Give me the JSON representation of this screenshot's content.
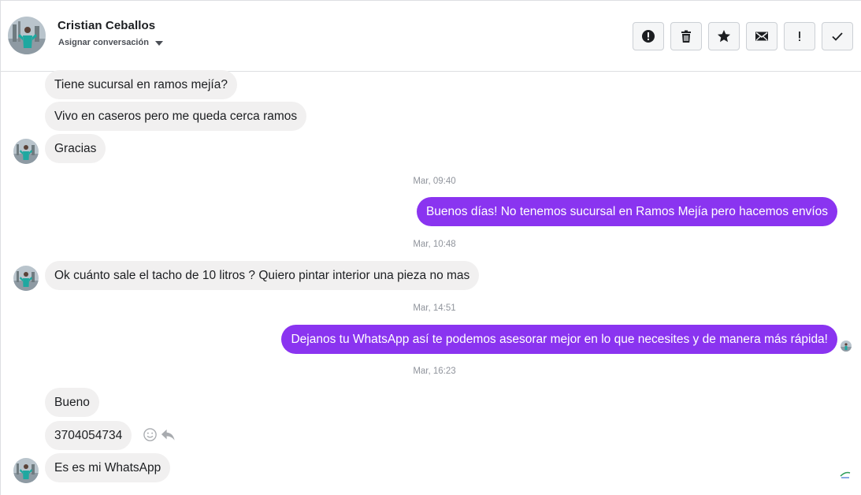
{
  "header": {
    "contact_name": "Cristian Ceballos",
    "assign_label": "Asignar conversación",
    "actions": [
      {
        "name": "alert-circle-icon"
      },
      {
        "name": "trash-icon"
      },
      {
        "name": "star-icon"
      },
      {
        "name": "envelope-icon"
      },
      {
        "name": "exclamation-icon"
      },
      {
        "name": "checkmark-icon"
      }
    ]
  },
  "messages": {
    "m1": "Tiene sucursal en ramos mejía?",
    "m2": "Vivo en caseros pero me queda cerca ramos",
    "m3": "Gracias",
    "t1": "Mar, 09:40",
    "m4": "Buenos días! No tenemos sucursal en Ramos Mejía pero hacemos envíos",
    "t2": "Mar, 10:48",
    "m5": "Ok cuánto sale el tacho de 10 litros ? Quiero pintar interior una pieza no mas",
    "t3": "Mar, 14:51",
    "m6": "Dejanos tu WhatsApp así te podemos asesorar mejor en lo que necesites y de manera más rápida!",
    "t4": "Mar, 16:23",
    "m7": "Bueno",
    "m8": "3704054734",
    "m9": "Es es mi WhatsApp"
  },
  "colors": {
    "outgoing_bubble": "#8a34f0",
    "incoming_bubble": "#f1f0f0",
    "timestamp": "#90949c"
  }
}
